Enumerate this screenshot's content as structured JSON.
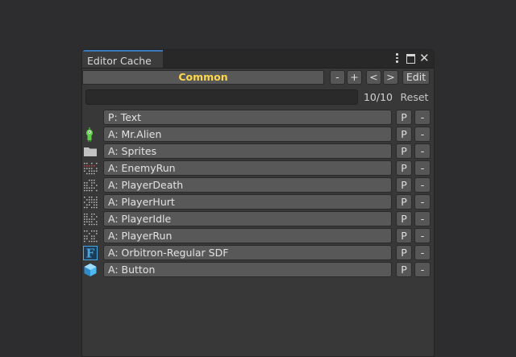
{
  "window": {
    "tab_title": "Editor Cache",
    "menu_icon": "kebab-menu-icon",
    "maximize_icon": "maximize-icon",
    "close_icon": "close-icon",
    "close_glyph": "✕"
  },
  "toolbar": {
    "group_label": "Common",
    "remove_group": "-",
    "add_group": "+",
    "prev_group": "<",
    "next_group": ">",
    "edit": "Edit"
  },
  "filter": {
    "value": "",
    "count": "10/10",
    "reset": "Reset"
  },
  "items": [
    {
      "label": "P: Text",
      "icon": "none",
      "pin": "P",
      "remove": "-"
    },
    {
      "label": "A: Mr.Alien",
      "icon": "alien-sprite-icon",
      "pin": "P",
      "remove": "-"
    },
    {
      "label": "A: Sprites",
      "icon": "folder-icon",
      "pin": "P",
      "remove": "-"
    },
    {
      "label": "A: EnemyRun",
      "icon": "animation-clip-icon",
      "pin": "P",
      "remove": "-"
    },
    {
      "label": "A: PlayerDeath",
      "icon": "animation-clip-icon",
      "pin": "P",
      "remove": "-"
    },
    {
      "label": "A: PlayerHurt",
      "icon": "animation-clip-icon",
      "pin": "P",
      "remove": "-"
    },
    {
      "label": "A: PlayerIdle",
      "icon": "animation-clip-icon",
      "pin": "P",
      "remove": "-"
    },
    {
      "label": "A: PlayerRun",
      "icon": "animation-clip-icon",
      "pin": "P",
      "remove": "-"
    },
    {
      "label": "A: Orbitron-Regular SDF",
      "icon": "font-asset-icon",
      "pin": "P",
      "remove": "-"
    },
    {
      "label": "A: Button",
      "icon": "prefab-cube-icon",
      "pin": "P",
      "remove": "-"
    }
  ],
  "colors": {
    "background": "#2d2d2f",
    "panel": "#383838",
    "group_label": "#ffd74a",
    "tab_accent": "#3a79bb",
    "font_icon": "#4aa8e0",
    "prefab_icon": "#4fb8f0",
    "alien_green": "#5fcf4a"
  }
}
